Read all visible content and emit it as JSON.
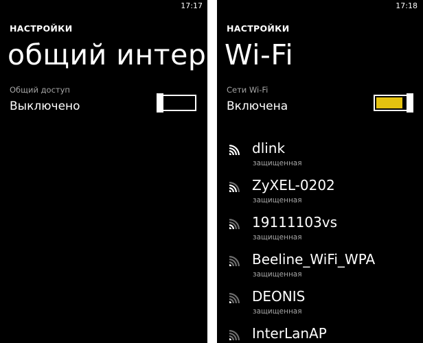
{
  "left_screen": {
    "time": "17:17",
    "app_title": "НАСТРОЙКИ",
    "page_title": "общий интерн",
    "setting_label": "Общий доступ",
    "setting_value": "Выключено",
    "toggle_on": false
  },
  "right_screen": {
    "time": "17:18",
    "app_title": "НАСТРОЙКИ",
    "page_title": "Wi-Fi",
    "setting_label": "Сети Wi-Fi",
    "setting_value": "Включена",
    "toggle_on": true,
    "accent_color": "#e5c210",
    "networks": [
      {
        "name": "dlink",
        "security": "защищенная",
        "signal_bars": 4
      },
      {
        "name": "ZyXEL-0202",
        "security": "защищенная",
        "signal_bars": 3
      },
      {
        "name": "19111103vs",
        "security": "защищенная",
        "signal_bars": 2
      },
      {
        "name": "Beeline_WiFi_WPA",
        "security": "защищенная",
        "signal_bars": 1
      },
      {
        "name": "DEONIS",
        "security": "защищенная",
        "signal_bars": 1
      },
      {
        "name": "InterLanAP",
        "security": "",
        "signal_bars": 1
      }
    ]
  },
  "icons": {
    "network": "wifi-signal-icon"
  }
}
